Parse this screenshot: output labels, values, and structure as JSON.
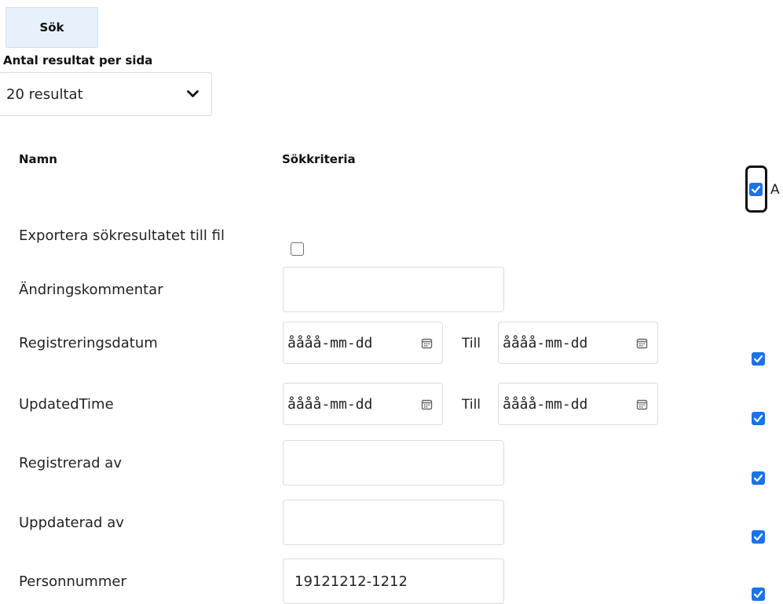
{
  "search_button": "Sök",
  "results_per_page": {
    "label": "Antal resultat per sida",
    "selected": "20 resultat"
  },
  "columns": {
    "name": "Namn",
    "criteria": "Sökkriteria"
  },
  "select_all_label_partial": "A",
  "export": {
    "label": "Exportera sökresultatet till fil",
    "checked": false
  },
  "rows": {
    "change_comment": {
      "label": "Ändringskommentar",
      "value": ""
    },
    "registration_date": {
      "label": "Registreringsdatum",
      "from_placeholder": "åååå-mm-dd",
      "till_label": "Till",
      "to_placeholder": "åååå-mm-dd",
      "checked": true
    },
    "updated_time": {
      "label": "UpdatedTime",
      "from_placeholder": "åååå-mm-dd",
      "till_label": "Till",
      "to_placeholder": "åååå-mm-dd",
      "checked": true
    },
    "registered_by": {
      "label": "Registrerad av",
      "value": "",
      "checked": true
    },
    "updated_by": {
      "label": "Uppdaterad av",
      "value": "",
      "checked": true
    },
    "personal_number": {
      "label": "Personnummer",
      "value": "19121212-1212",
      "checked": true
    }
  },
  "colors": {
    "accent": "#1a73e8",
    "button_bg": "#e7f1fb",
    "border": "#dcdcdc"
  }
}
